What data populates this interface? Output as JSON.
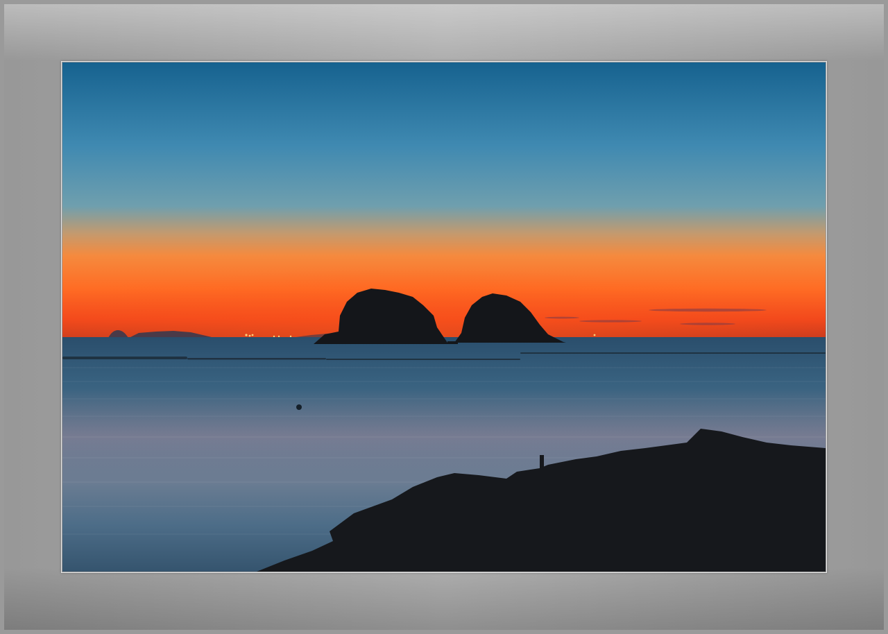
{
  "photo": {
    "scene": "sunset-seascape",
    "colors": {
      "sky_top": "#1a6696",
      "sky_mid": "#4f95b8",
      "horizon_glow": "#ff6a22",
      "sea": "#38607e",
      "silhouette": "#121418",
      "frame_mat": "#a9a9a9"
    }
  }
}
